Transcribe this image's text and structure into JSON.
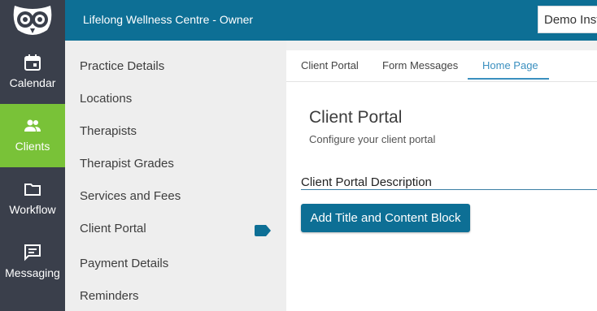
{
  "header": {
    "title": "Lifelong Wellness Centre - Owner",
    "account_label": "Demo Inst",
    "color": "#0d6f95"
  },
  "rail": {
    "items": [
      {
        "label": "Calendar",
        "icon": "calendar-icon"
      },
      {
        "label": "Clients",
        "icon": "people-icon",
        "active": true,
        "active_color": "#79c238"
      },
      {
        "label": "Workflow",
        "icon": "folder-icon"
      },
      {
        "label": "Messaging",
        "icon": "message-icon"
      }
    ]
  },
  "menu": {
    "items": [
      {
        "label": "Practice Details"
      },
      {
        "label": "Locations"
      },
      {
        "label": "Therapists"
      },
      {
        "label": "Therapist Grades"
      },
      {
        "label": "Services and Fees"
      },
      {
        "label": "Client Portal",
        "selected": true
      },
      {
        "label": "Payment Details"
      },
      {
        "label": "Reminders"
      }
    ]
  },
  "tabs": [
    {
      "label": "Client Portal"
    },
    {
      "label": "Form Messages"
    },
    {
      "label": "Home Page",
      "active": true
    }
  ],
  "main": {
    "title": "Client Portal",
    "subtitle": "Configure your client portal",
    "section_title": "Client Portal Description",
    "add_button": "Add Title and Content Block"
  }
}
